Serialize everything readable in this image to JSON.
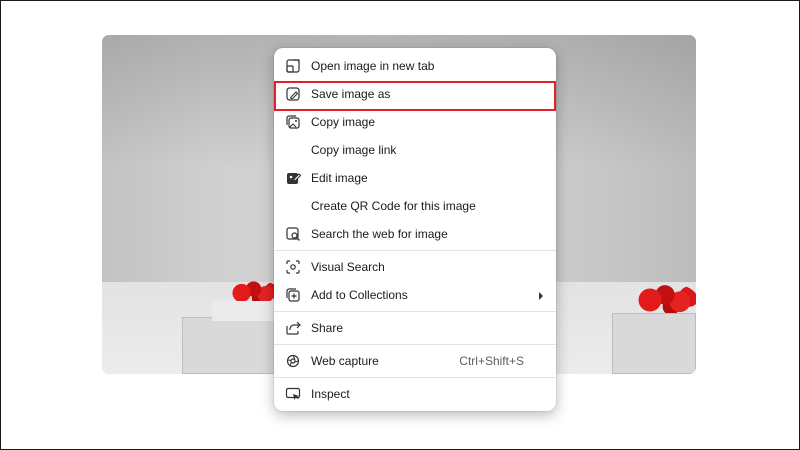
{
  "menu": {
    "items": [
      {
        "label": "Open image in new tab",
        "icon": "open-new-tab-icon"
      },
      {
        "label": "Save image as",
        "icon": "save-image-icon",
        "highlighted": true
      },
      {
        "label": "Copy image",
        "icon": "copy-image-icon"
      },
      {
        "label": "Copy image link",
        "icon": null
      },
      {
        "label": "Edit image",
        "icon": "edit-image-icon"
      },
      {
        "label": "Create QR Code for this image",
        "icon": null
      },
      {
        "label": "Search the web for image",
        "icon": "search-web-image-icon"
      },
      {
        "label": "Visual Search",
        "icon": "visual-search-icon"
      },
      {
        "label": "Add to Collections",
        "icon": "collections-icon",
        "submenu": true
      },
      {
        "label": "Share",
        "icon": "share-icon"
      },
      {
        "label": "Web capture",
        "icon": "web-capture-icon",
        "shortcut": "Ctrl+Shift+S"
      },
      {
        "label": "Inspect",
        "icon": "inspect-icon"
      }
    ]
  },
  "colors": {
    "highlight_border": "#e2202a",
    "menu_bg": "#ffffff",
    "text": "#1b1b1b"
  }
}
